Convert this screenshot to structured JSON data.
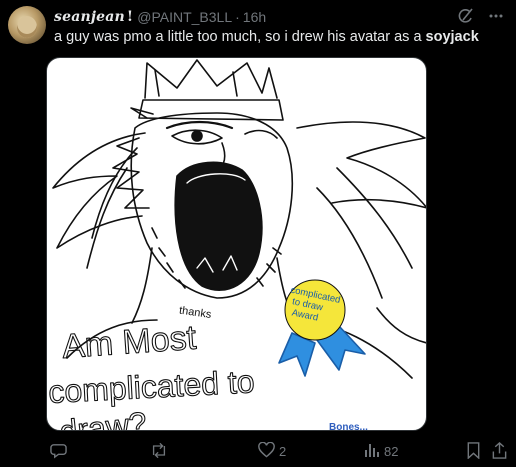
{
  "post": {
    "display_name": "seanjean",
    "name_suffix": "!",
    "handle": "@PAINT_B3LL",
    "separator": "·",
    "time": "16h",
    "text_main": "a guy was pmo a little too much, so i drew his avatar as a ",
    "text_bold": "soyjack"
  },
  "drawing": {
    "shirt_text_line1": "Am Most",
    "shirt_text_line2": "complicated to",
    "shirt_text_line3": "draw?",
    "badge_text": "complicated to draw Award",
    "beard_text": "thanks",
    "corner_text": "Bones..."
  },
  "actions": {
    "reply_count": "",
    "repost_count": "",
    "like_count": "2",
    "views_count": "82"
  },
  "icons": {
    "grok": "grok-icon",
    "more": "more-icon",
    "reply": "reply-icon",
    "repost": "repost-icon",
    "like": "like-icon",
    "views": "views-icon",
    "bookmark": "bookmark-icon",
    "share": "share-icon"
  },
  "colors": {
    "background": "#000000",
    "text": "#e7e9ea",
    "muted": "#71767b",
    "badge_yellow": "#f5e63a",
    "ribbon_blue": "#2f8fe0"
  }
}
